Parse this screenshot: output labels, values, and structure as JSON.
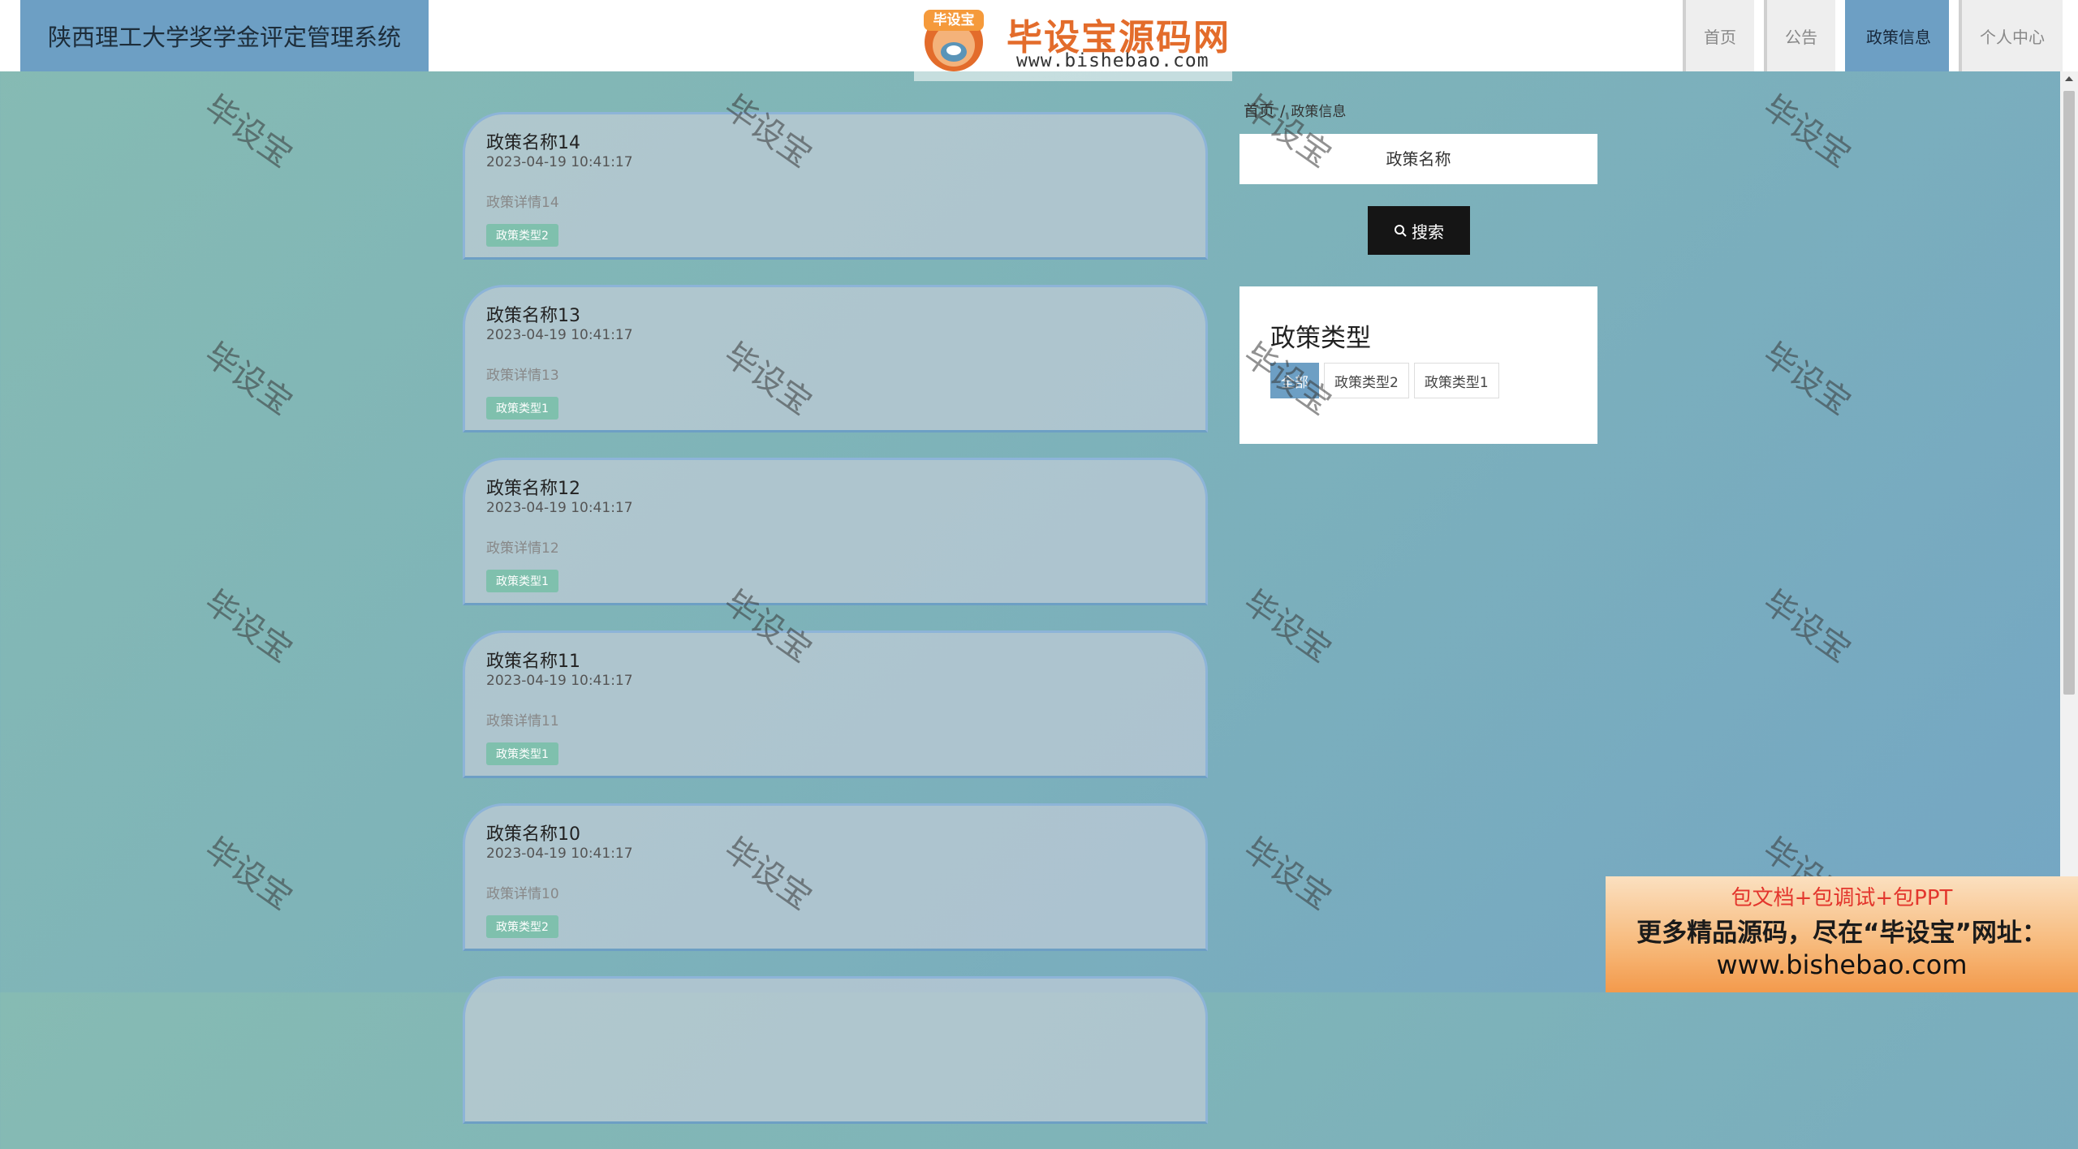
{
  "header": {
    "site_title": "陕西理工大学奖学金评定管理系统",
    "logo_text": "毕设宝源码网",
    "logo_url": "www.bishebao.com",
    "logo_badge": "毕设宝"
  },
  "nav": [
    {
      "label": "首页",
      "active": false
    },
    {
      "label": "公告",
      "active": false
    },
    {
      "label": "政策信息",
      "active": true
    },
    {
      "label": "个人中心",
      "active": false
    }
  ],
  "policies": [
    {
      "title": "政策名称14",
      "date": "2023-04-19 10:41:17",
      "detail": "政策详情14",
      "type": "政策类型2"
    },
    {
      "title": "政策名称13",
      "date": "2023-04-19 10:41:17",
      "detail": "政策详情13",
      "type": "政策类型1"
    },
    {
      "title": "政策名称12",
      "date": "2023-04-19 10:41:17",
      "detail": "政策详情12",
      "type": "政策类型1"
    },
    {
      "title": "政策名称11",
      "date": "2023-04-19 10:41:17",
      "detail": "政策详情11",
      "type": "政策类型1"
    },
    {
      "title": "政策名称10",
      "date": "2023-04-19 10:41:17",
      "detail": "政策详情10",
      "type": "政策类型2"
    }
  ],
  "breadcrumb": {
    "home": "首页",
    "separator": "/",
    "current": "政策信息"
  },
  "search": {
    "placeholder": "政策名称",
    "button_label": "搜索"
  },
  "type_panel": {
    "title": "政策类型",
    "items": [
      {
        "label": "全部",
        "active": true
      },
      {
        "label": "政策类型2",
        "active": false
      },
      {
        "label": "政策类型1",
        "active": false
      }
    ]
  },
  "watermark_text": "毕设宝",
  "ad": {
    "line1": "包文档+包调试+包PPT",
    "line2": "更多精品源码，尽在“毕设宝”网址：",
    "line3": "www.bishebao.com"
  },
  "colors": {
    "accent": "#6d9fc4",
    "tag": "#7fc0ad",
    "search_button": "#151515"
  }
}
